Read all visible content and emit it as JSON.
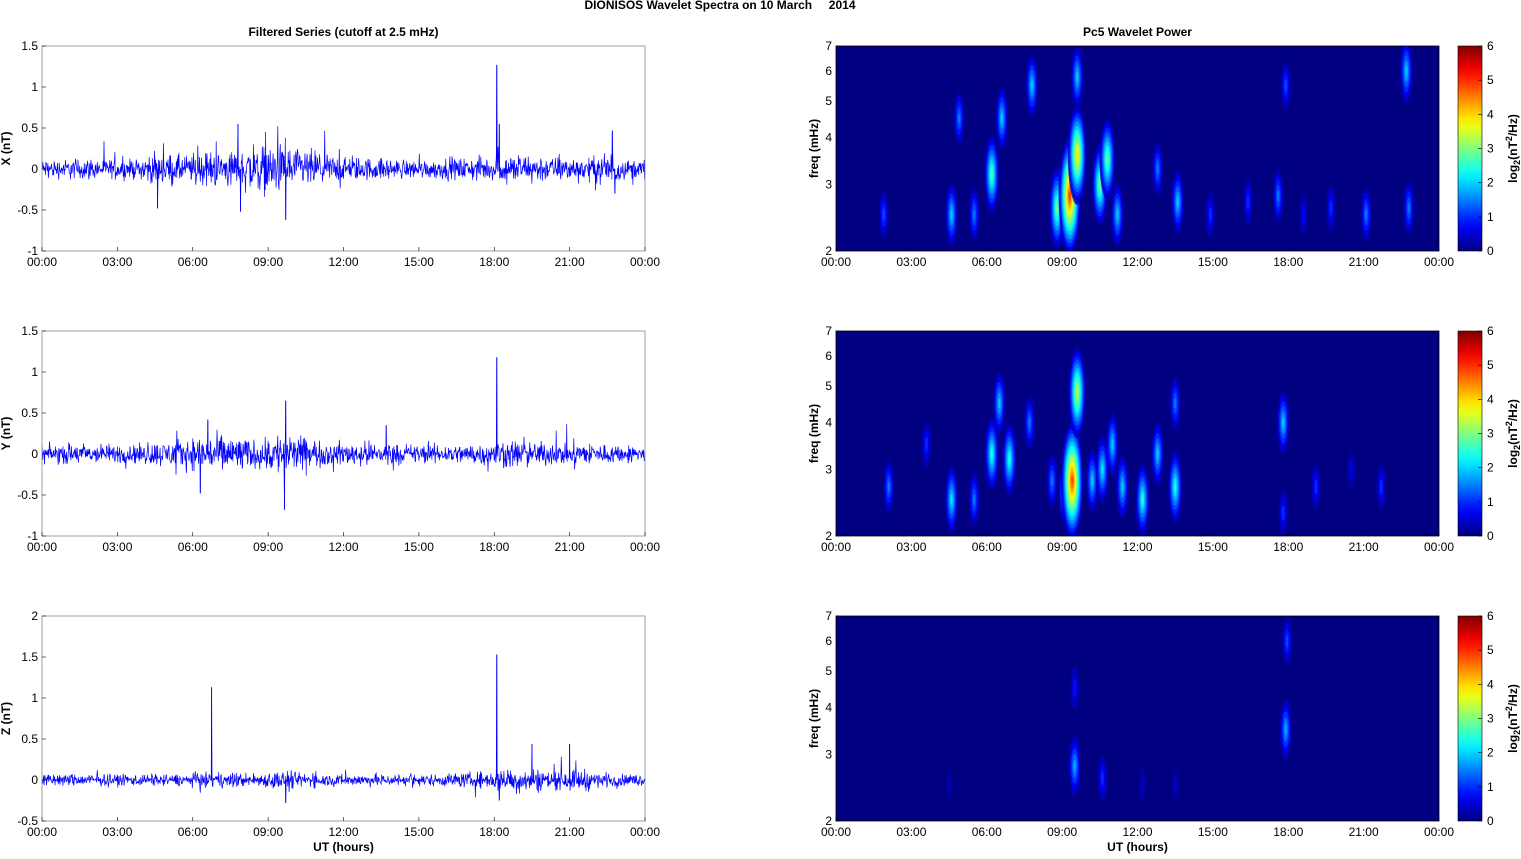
{
  "title": "DIONISOS Wavelet Spectra on 10 March     2014",
  "chart_data": [
    {
      "type": "line",
      "title": "Filtered Series (cutoff at 2.5 mHz)",
      "ylabel": "X (nT)",
      "xlabel": "",
      "xlim": [
        0,
        24
      ],
      "ylim": [
        -1,
        1.5
      ],
      "yticks": [
        "1.5",
        "1",
        "0.5",
        "0",
        "-0.5",
        "-1"
      ],
      "ytick_values": [
        1.5,
        1,
        0.5,
        0,
        -0.5,
        -1
      ],
      "color": "#0000ff",
      "noise_amplitude_by_hour": [
        0.08,
        0.09,
        0.08,
        0.08,
        0.12,
        0.12,
        0.14,
        0.16,
        0.2,
        0.2,
        0.16,
        0.12,
        0.1,
        0.09,
        0.08,
        0.08,
        0.09,
        0.1,
        0.12,
        0.12,
        0.1,
        0.1,
        0.14,
        0.08
      ],
      "spikes": [
        [
          18.1,
          1.27
        ],
        [
          18.2,
          0.55
        ],
        [
          7.8,
          0.55
        ],
        [
          9.7,
          -0.62
        ],
        [
          7.9,
          -0.52
        ],
        [
          4.6,
          -0.48
        ],
        [
          22.7,
          0.47
        ],
        [
          22.8,
          -0.3
        ]
      ]
    },
    {
      "type": "line",
      "title": "",
      "ylabel": "Y (nT)",
      "xlabel": "",
      "xlim": [
        0,
        24
      ],
      "ylim": [
        -1,
        1.5
      ],
      "yticks": [
        "1.5",
        "1",
        "0.5",
        "0",
        "-0.5",
        "-1"
      ],
      "ytick_values": [
        1.5,
        1,
        0.5,
        0,
        -0.5,
        -1
      ],
      "color": "#0000ff",
      "noise_amplitude_by_hour": [
        0.08,
        0.09,
        0.08,
        0.08,
        0.1,
        0.12,
        0.15,
        0.16,
        0.12,
        0.18,
        0.14,
        0.1,
        0.1,
        0.1,
        0.08,
        0.08,
        0.08,
        0.09,
        0.12,
        0.1,
        0.09,
        0.1,
        0.08,
        0.07
      ],
      "spikes": [
        [
          18.1,
          1.18
        ],
        [
          9.7,
          0.65
        ],
        [
          9.65,
          -0.68
        ],
        [
          6.6,
          0.42
        ],
        [
          6.3,
          -0.48
        ],
        [
          13.7,
          0.35
        ]
      ]
    },
    {
      "type": "line",
      "title": "",
      "ylabel": "Z (nT)",
      "xlabel": "UT (hours)",
      "xlim": [
        0,
        24
      ],
      "ylim": [
        -0.5,
        2
      ],
      "yticks": [
        "2",
        "1.5",
        "1",
        "0.5",
        "0",
        "-0.5"
      ],
      "ytick_values": [
        2,
        1.5,
        1,
        0.5,
        0,
        -0.5
      ],
      "color": "#0000ff",
      "noise_amplitude_by_hour": [
        0.05,
        0.05,
        0.05,
        0.05,
        0.05,
        0.05,
        0.06,
        0.06,
        0.06,
        0.08,
        0.06,
        0.05,
        0.05,
        0.05,
        0.05,
        0.05,
        0.06,
        0.07,
        0.1,
        0.1,
        0.08,
        0.09,
        0.06,
        0.05
      ],
      "spikes": [
        [
          6.75,
          1.13
        ],
        [
          18.1,
          1.53
        ],
        [
          18.2,
          -0.25
        ],
        [
          19.5,
          0.44
        ],
        [
          21,
          0.44
        ],
        [
          9.7,
          -0.28
        ]
      ]
    },
    {
      "type": "heatmap",
      "title": "Pc5 Wavelet Power",
      "ylabel": "freq (mHz)",
      "xlabel": "",
      "xlim": [
        0,
        24
      ],
      "ylim": [
        2,
        7
      ],
      "yscale": "log",
      "yticks": [
        "2",
        "3",
        "4",
        "5",
        "6",
        "7"
      ],
      "ytick_values": [
        2,
        3,
        4,
        5,
        6,
        7
      ],
      "colorbar": {
        "label": "log2(nT²/Hz)",
        "range": [
          0,
          6
        ],
        "ticks": [
          "0",
          "1",
          "2",
          "3",
          "4",
          "5",
          "6"
        ]
      },
      "blobs_hour_freq_power": [
        [
          1.9,
          2.5,
          1.2
        ],
        [
          4.6,
          2.5,
          2
        ],
        [
          4.9,
          4.5,
          1.5
        ],
        [
          5.5,
          2.5,
          1.5
        ],
        [
          6.2,
          3.2,
          2.8
        ],
        [
          6.6,
          4.5,
          2
        ],
        [
          7.8,
          5.5,
          2
        ],
        [
          8.8,
          2.6,
          3
        ],
        [
          9.3,
          2.8,
          5
        ],
        [
          9.6,
          3.6,
          4
        ],
        [
          9.6,
          5.8,
          2
        ],
        [
          10.5,
          3.0,
          3
        ],
        [
          10.8,
          3.5,
          3
        ],
        [
          11.2,
          2.5,
          2
        ],
        [
          12.8,
          3.3,
          1.5
        ],
        [
          13.6,
          2.7,
          2
        ],
        [
          14.9,
          2.5,
          1
        ],
        [
          16.4,
          2.7,
          1
        ],
        [
          17.6,
          2.8,
          1.5
        ],
        [
          17.9,
          5.5,
          1.2
        ],
        [
          18.6,
          2.5,
          0.7
        ],
        [
          19.7,
          2.6,
          1
        ],
        [
          21.1,
          2.5,
          1.5
        ],
        [
          22.7,
          6,
          2
        ],
        [
          22.8,
          2.6,
          1.5
        ]
      ]
    },
    {
      "type": "heatmap",
      "title": "",
      "ylabel": "freq (mHz)",
      "xlabel": "",
      "xlim": [
        0,
        24
      ],
      "ylim": [
        2,
        7
      ],
      "yscale": "log",
      "yticks": [
        "2",
        "3",
        "4",
        "5",
        "6",
        "7"
      ],
      "ytick_values": [
        2,
        3,
        4,
        5,
        6,
        7
      ],
      "colorbar": {
        "label": "log2(nT²/Hz)",
        "range": [
          0,
          6
        ],
        "ticks": [
          "0",
          "1",
          "2",
          "3",
          "4",
          "5",
          "6"
        ]
      },
      "blobs_hour_freq_power": [
        [
          2.1,
          2.7,
          1.5
        ],
        [
          3.6,
          3.5,
          1
        ],
        [
          4.6,
          2.5,
          2.2
        ],
        [
          5.5,
          2.5,
          1.5
        ],
        [
          6.2,
          3.3,
          2.5
        ],
        [
          6.5,
          4.5,
          2
        ],
        [
          6.9,
          3.2,
          2.5
        ],
        [
          7.7,
          4,
          1.5
        ],
        [
          8.6,
          2.8,
          1.5
        ],
        [
          9.1,
          2.6,
          2
        ],
        [
          9.4,
          2.8,
          5
        ],
        [
          9.6,
          4.8,
          3.5
        ],
        [
          10.2,
          2.8,
          2
        ],
        [
          10.6,
          3,
          2.2
        ],
        [
          11,
          3.5,
          2
        ],
        [
          11.4,
          2.7,
          2
        ],
        [
          12.2,
          2.5,
          2.5
        ],
        [
          12.8,
          3.3,
          2
        ],
        [
          13.5,
          2.7,
          2.5
        ],
        [
          13.5,
          4.5,
          1.5
        ],
        [
          17.8,
          4,
          2
        ],
        [
          17.8,
          2.3,
          1
        ],
        [
          19.1,
          2.7,
          1
        ],
        [
          20.5,
          3,
          0.6
        ],
        [
          21.7,
          2.7,
          1
        ]
      ]
    },
    {
      "type": "heatmap",
      "title": "",
      "ylabel": "freq (mHz)",
      "xlabel": "UT (hours)",
      "xlim": [
        0,
        24
      ],
      "ylim": [
        2,
        7
      ],
      "yscale": "log",
      "yticks": [
        "2",
        "3",
        "4",
        "5",
        "6",
        "7"
      ],
      "ytick_values": [
        2,
        3,
        4,
        5,
        6,
        7
      ],
      "colorbar": {
        "label": "log2(nT²/Hz)",
        "range": [
          0,
          6
        ],
        "ticks": [
          "0",
          "1",
          "2",
          "3",
          "4",
          "5",
          "6"
        ]
      },
      "blobs_hour_freq_power": [
        [
          9.5,
          2.8,
          1.8
        ],
        [
          9.5,
          4.5,
          0.8
        ],
        [
          10.6,
          2.6,
          1
        ],
        [
          12.2,
          2.5,
          0.4
        ],
        [
          13.5,
          2.5,
          0.4
        ],
        [
          17.9,
          3.5,
          1.8
        ],
        [
          17.95,
          6,
          1.2
        ],
        [
          4.5,
          2.5,
          0.3
        ]
      ]
    }
  ],
  "xticks": [
    "00:00",
    "03:00",
    "06:00",
    "09:00",
    "12:00",
    "15:00",
    "18:00",
    "21:00",
    "00:00"
  ]
}
